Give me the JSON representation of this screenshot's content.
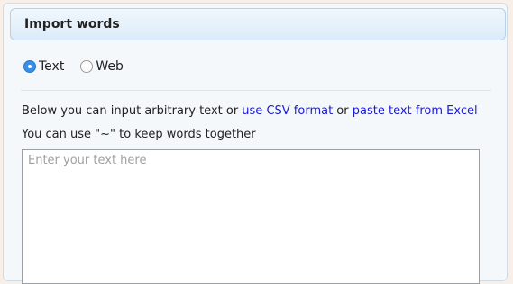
{
  "panel": {
    "title": "Import words"
  },
  "mode": {
    "options": [
      {
        "label": "Text",
        "checked": true
      },
      {
        "label": "Web",
        "checked": false
      }
    ]
  },
  "info": {
    "line1_prefix": "Below you can input arbitrary text or ",
    "csv_link": "use CSV format",
    "line1_middle": " or ",
    "excel_link": "paste text from Excel",
    "line2": "You can use \"~\" to keep words together"
  },
  "input": {
    "placeholder": "Enter your text here",
    "value": ""
  },
  "colors": {
    "link": "#1a1ad6",
    "radio_accent": "#3b8ee8"
  }
}
